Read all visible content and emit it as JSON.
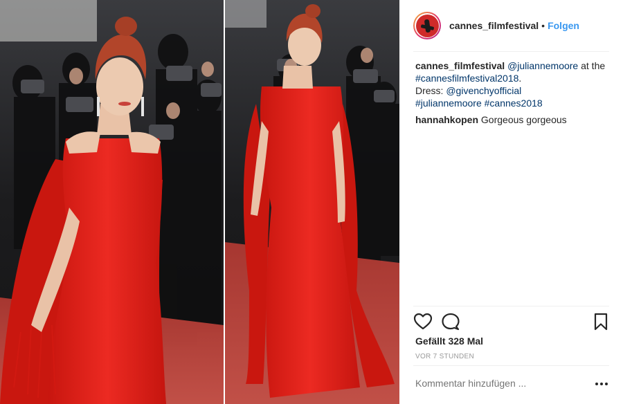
{
  "post": {
    "photo": {
      "description_icon": "red-carpet-photo",
      "colors": {
        "dress": "#e0241f",
        "carpet": "#c8423a",
        "background": "#1f1f21"
      }
    }
  },
  "header": {
    "username": "cannes_filmfestival",
    "separator": "•",
    "follow_label": "Folgen",
    "avatar_icon": "profile-avatar"
  },
  "caption": {
    "username": "cannes_filmfestival",
    "mention_1": "@juliannemoore",
    "text_1": " at the ",
    "hashtag_1": "#cannesfilmfestival2018",
    "text_2": ".",
    "dress_label": "Dress: ",
    "mention_2": "@givenchyofficial",
    "hashtag_2": "#juliannemoore",
    "hashtag_3": "#cannes2018"
  },
  "comments": [
    {
      "username": "hannahkopen",
      "text": "Gorgeous gorgeous"
    }
  ],
  "actions": {
    "like_icon": "heart-icon",
    "comment_icon": "comment-icon",
    "save_icon": "bookmark-icon"
  },
  "likes_text": "Gefällt 328 Mal",
  "timestamp": "VOR 7 STUNDEN",
  "comment_input": {
    "placeholder": "Kommentar hinzufügen ...",
    "more_icon": "more-options-icon"
  },
  "colors": {
    "link": "#003569",
    "follow": "#3897f0",
    "text": "#262626",
    "muted": "#999999"
  }
}
